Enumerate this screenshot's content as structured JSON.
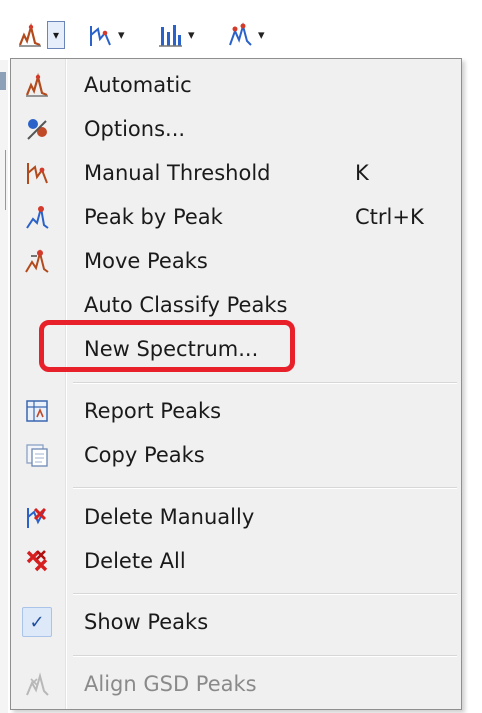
{
  "toolbar": {
    "buttons": [
      {
        "icon": "peak-picking-icon",
        "has_split_dropdown": true
      },
      {
        "icon": "manual-threshold-icon",
        "has_dropdown": true
      },
      {
        "icon": "peak-bars-icon",
        "has_dropdown": true
      },
      {
        "icon": "peak-options-icon",
        "has_dropdown": true
      }
    ],
    "arrow": "▾"
  },
  "menu": {
    "items": [
      {
        "label": "Automatic",
        "shortcut": "",
        "icon": "automatic-peak-icon",
        "enabled": true
      },
      {
        "label": "Options...",
        "shortcut": "",
        "icon": "options-icon",
        "enabled": true
      },
      {
        "label": "Manual Threshold",
        "shortcut": "K",
        "icon": "manual-threshold-icon",
        "enabled": true
      },
      {
        "label": "Peak by Peak",
        "shortcut": "Ctrl+K",
        "icon": "peak-by-peak-icon",
        "enabled": true
      },
      {
        "label": "Move Peaks",
        "shortcut": "",
        "icon": "move-peaks-icon",
        "enabled": true
      },
      {
        "label": "Auto Classify Peaks",
        "shortcut": "",
        "icon": "",
        "enabled": true
      },
      {
        "label": "New Spectrum...",
        "shortcut": "",
        "icon": "",
        "enabled": true,
        "highlighted": true
      },
      {
        "label": "Report Peaks",
        "shortcut": "",
        "icon": "report-peaks-icon",
        "enabled": true
      },
      {
        "label": "Copy Peaks",
        "shortcut": "",
        "icon": "copy-peaks-icon",
        "enabled": true
      },
      {
        "label": "Delete Manually",
        "shortcut": "",
        "icon": "delete-manually-icon",
        "enabled": true
      },
      {
        "label": "Delete All",
        "shortcut": "",
        "icon": "delete-all-icon",
        "enabled": true
      },
      {
        "label": "Show Peaks",
        "shortcut": "",
        "icon": "checkmark-icon",
        "enabled": true,
        "checked": true,
        "check_glyph": "✓"
      },
      {
        "label": "Align GSD Peaks",
        "shortcut": "",
        "icon": "align-gsd-icon",
        "enabled": false
      }
    ]
  },
  "colors": {
    "highlight_border": "#e8202a",
    "menu_background": "#f0f0f0",
    "disabled_text": "#8a8a8a"
  }
}
